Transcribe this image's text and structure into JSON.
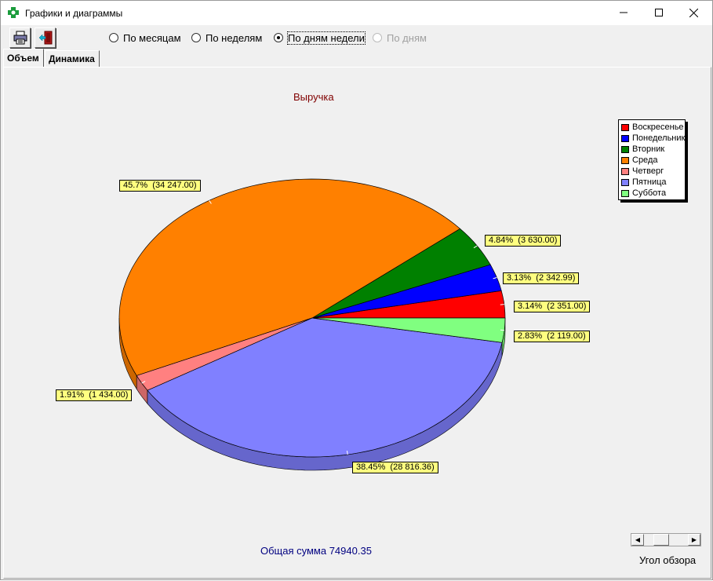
{
  "window": {
    "title": "Графики и диаграммы"
  },
  "toolbar": {
    "print_icon": "printer-icon",
    "exit_icon": "exit-door-icon",
    "modes": [
      {
        "label": "По месяцам",
        "checked": false,
        "disabled": false
      },
      {
        "label": "По неделям",
        "checked": false,
        "disabled": false
      },
      {
        "label": "По дням недели",
        "checked": true,
        "disabled": false
      },
      {
        "label": "По дням",
        "checked": false,
        "disabled": true
      }
    ]
  },
  "tabs": [
    {
      "label": "Объем",
      "active": true
    },
    {
      "label": "Динамика",
      "active": false
    }
  ],
  "total": "Общая сумма 74940.35",
  "view_angle": {
    "label": "Угол обзора"
  },
  "colors": {
    "title": "#800000",
    "total": "#000080",
    "label_bg": "#ffff80"
  },
  "chart_data": {
    "type": "pie",
    "title": "Выручка",
    "legend_position": "top-right",
    "series": [
      {
        "name": "Воскресенье",
        "value": 2351.0,
        "percent": "3.14%",
        "label": "3.14%  (2 351.00)",
        "color": "#ff0000"
      },
      {
        "name": "Понедельник",
        "value": 2342.99,
        "percent": "3.13%",
        "label": "3.13%  (2 342.99)",
        "color": "#0000ff"
      },
      {
        "name": "Вторник",
        "value": 3630.0,
        "percent": "4.84%",
        "label": "4.84%  (3 630.00)",
        "color": "#008000"
      },
      {
        "name": "Среда",
        "value": 34247.0,
        "percent": "45.7%",
        "label": "45.7%  (34 247.00)",
        "color": "#ff8000"
      },
      {
        "name": "Четверг",
        "value": 1434.0,
        "percent": "1.91%",
        "label": "1.91%  (1 434.00)",
        "color": "#ff8080"
      },
      {
        "name": "Пятница",
        "value": 28816.36,
        "percent": "38.45%",
        "label": "38.45%  (28 816.36)",
        "color": "#8080ff"
      },
      {
        "name": "Суббота",
        "value": 2119.0,
        "percent": "2.83%",
        "label": "2.83%  (2 119.00)",
        "color": "#80ff80"
      }
    ]
  }
}
